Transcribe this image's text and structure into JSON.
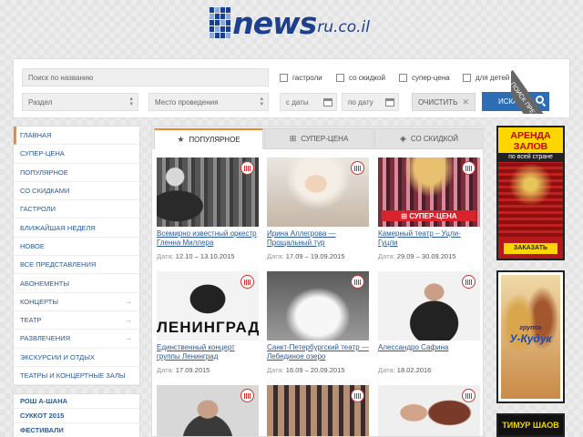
{
  "logo": {
    "brand": "news",
    "domain": "ru.co.il"
  },
  "search": {
    "name_placeholder": "Поиск по названию",
    "section_placeholder": "Раздел",
    "venue_placeholder": "Место проведения",
    "date_from_placeholder": "с даты",
    "date_to_placeholder": "по дату",
    "checkboxes": [
      "гастроли",
      "со скидкой",
      "супер-цена",
      "для детей"
    ],
    "clear_label": "ОЧИСТИТЬ",
    "submit_label": "ИСКАТЬ",
    "corner_label": "ПОИСК ПРЕДСТАВЛЕНИЯ"
  },
  "sidebar": {
    "items": [
      {
        "label": "ГЛАВНАЯ"
      },
      {
        "label": "СУПЕР-ЦЕНА"
      },
      {
        "label": "ПОПУЛЯРНОЕ"
      },
      {
        "label": "СО СКИДКАМИ"
      },
      {
        "label": "ГАСТРОЛИ"
      },
      {
        "label": "БЛИЖАЙШАЯ НЕДЕЛЯ"
      },
      {
        "label": "НОВОЕ"
      },
      {
        "label": "ВСЕ ПРЕДСТАВЛЕНИЯ"
      },
      {
        "label": "АБОНЕМЕНТЫ"
      },
      {
        "label": "КОНЦЕРТЫ",
        "arrow": "→"
      },
      {
        "label": "ТЕАТР",
        "arrow": "→"
      },
      {
        "label": "РАЗВЛЕЧЕНИЯ",
        "arrow": "→"
      },
      {
        "label": "ЭКСКУРСИИ И ОТДЫХ"
      },
      {
        "label": "ТЕАТРЫ И КОНЦЕРТНЫЕ ЗАЛЫ"
      }
    ],
    "items2": [
      {
        "label": "РОШ А-ШАНА"
      },
      {
        "label": "СУККОТ 2015"
      },
      {
        "label": "ФЕСТИВАЛИ"
      }
    ]
  },
  "tabs": [
    {
      "label": "ПОПУЛЯРНОЕ",
      "icon": "star-icon",
      "glyph": "★"
    },
    {
      "label": "СУПЕР-ЦЕНА",
      "icon": "gift-icon",
      "glyph": "⊞"
    },
    {
      "label": "СО СКИДКОЙ",
      "icon": "tag-icon",
      "glyph": "◈"
    }
  ],
  "date_label": "Дата:",
  "cards": [
    {
      "title": "Всемирно известный оркестр Гленна Миллера",
      "date": "12.10 – 13.10.2015"
    },
    {
      "title": "Ирина Аллегрова — Прощальный тур",
      "date": "17.09 – 19.09.2015"
    },
    {
      "title": "Камерный театр – Уцли-Гуцли",
      "date": "29.09 – 30.09.2015",
      "band": "СУПЕР-ЦЕНА"
    },
    {
      "title": "Единственный концерт группы Ленинград",
      "date": "17.09.2015",
      "art_text": "ЛЕНИНГРАД"
    },
    {
      "title": "Санкт-Петербургский театр — Лебединое озеро",
      "date": "16.09 – 20.09.2015"
    },
    {
      "title": "Алессандро Сафина",
      "date": "18.02.2016"
    },
    {
      "title": "",
      "date": ""
    },
    {
      "title": "",
      "date": ""
    },
    {
      "title": "",
      "date": ""
    }
  ],
  "banners": {
    "hall": {
      "head": "АРЕНДА ЗАЛОВ",
      "sub": "по всей стране",
      "button": "ЗАКАЗАТЬ"
    },
    "show": {
      "group": "группа",
      "name": "У-Кудук"
    },
    "artist": {
      "name": "ТИМУР ШАОВ"
    }
  },
  "colors": {
    "accent": "#f08c2c",
    "brand": "#1d3f8e",
    "link": "#2a5a9a",
    "search_button": "#2d6db5",
    "super_price": "#d8222c"
  }
}
